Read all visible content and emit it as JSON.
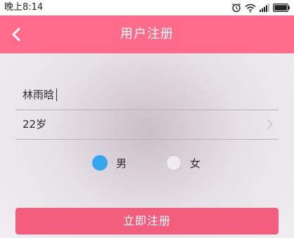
{
  "status_bar": {
    "time": "晚上8:14",
    "icons": [
      "alarm-icon",
      "wifi-icon",
      "signal-icon",
      "battery-icon"
    ]
  },
  "app_bar": {
    "title": "用户注册",
    "back_icon": "chevron-left-icon",
    "color": "#fe6b8b"
  },
  "form": {
    "name_value": "林雨晗",
    "age_value": "22岁",
    "gender": {
      "options": [
        {
          "label": "男",
          "checked": true
        },
        {
          "label": "女",
          "checked": false
        }
      ],
      "checked_color": "#35a6f0"
    },
    "submit_label": "立即注册",
    "submit_color": "#f45e7e"
  }
}
